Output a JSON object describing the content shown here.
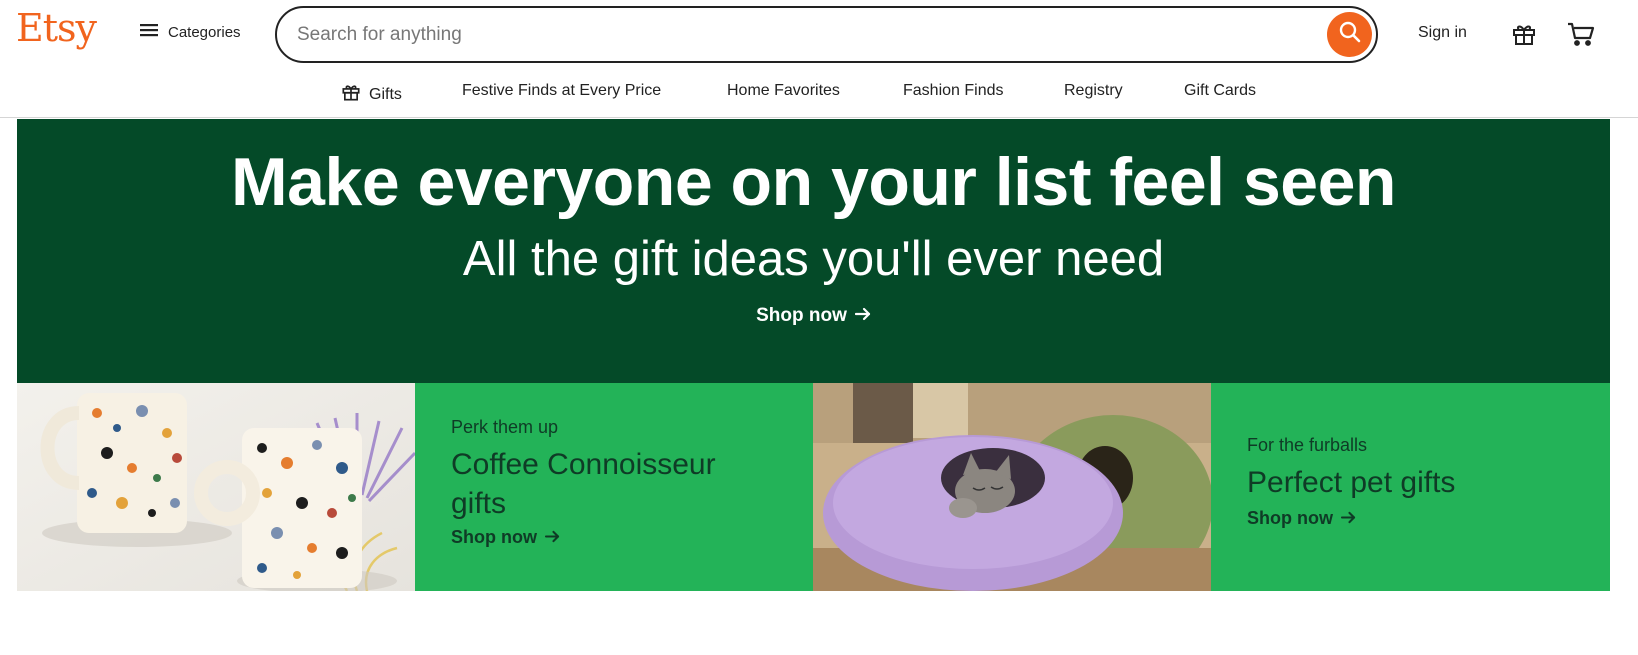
{
  "header": {
    "logo": "Etsy",
    "categories_label": "Categories",
    "search_placeholder": "Search for anything",
    "sign_in": "Sign in"
  },
  "nav": {
    "items": [
      {
        "label": "Gifts",
        "icon": "gift-icon"
      },
      {
        "label": "Festive Finds at Every Price"
      },
      {
        "label": "Home Favorites"
      },
      {
        "label": "Fashion Finds"
      },
      {
        "label": "Registry"
      },
      {
        "label": "Gift Cards"
      }
    ]
  },
  "hero": {
    "title": "Make everyone on your list feel seen",
    "subtitle": "All the gift ideas you'll ever need",
    "cta": "Shop now"
  },
  "promos": [
    {
      "kicker": "Perk them up",
      "title": "Coffee Connoisseur gifts",
      "cta": "Shop now"
    },
    {
      "kicker": "For the furballs",
      "title": "Perfect pet gifts",
      "cta": "Shop now"
    }
  ],
  "colors": {
    "brand": "#F1641E",
    "hero_bg": "#044A28",
    "promo_bg": "#23B358",
    "promo_text": "#0F3B26"
  }
}
